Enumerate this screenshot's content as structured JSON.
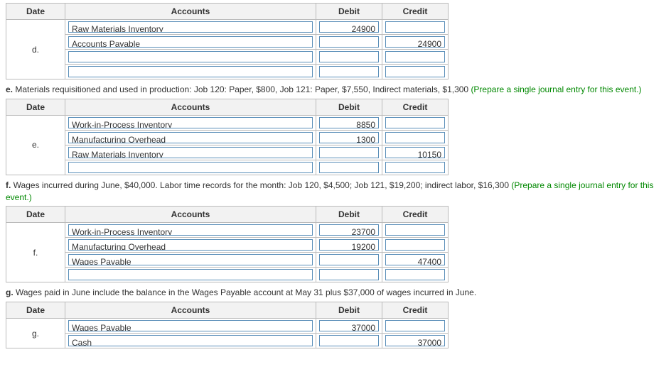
{
  "headers": {
    "date": "Date",
    "accounts": "Accounts",
    "debit": "Debit",
    "credit": "Credit"
  },
  "entries": [
    {
      "id": "d",
      "narrative": null,
      "rows": [
        {
          "account": "Raw Materials Inventory",
          "debit": "24900",
          "credit": ""
        },
        {
          "account": "Accounts Payable",
          "debit": "",
          "credit": "24900"
        },
        {
          "account": "",
          "debit": "",
          "credit": ""
        },
        {
          "account": "",
          "debit": "",
          "credit": ""
        }
      ]
    },
    {
      "id": "e",
      "narrative": {
        "letter": "e.",
        "text": " Materials requisitioned and used in production: Job 120: Paper, $800, Job 121: Paper, $7,550, Indirect materials, $1,300 ",
        "green": "(Prepare a single journal entry for this event.)"
      },
      "rows": [
        {
          "account": "Work-in-Process Inventory",
          "debit": "8850",
          "credit": ""
        },
        {
          "account": "Manufacturing Overhead",
          "debit": "1300",
          "credit": ""
        },
        {
          "account": "Raw Materials Inventory",
          "debit": "",
          "credit": "10150"
        },
        {
          "account": "",
          "debit": "",
          "credit": ""
        }
      ]
    },
    {
      "id": "f",
      "narrative": {
        "letter": "f.",
        "text": " Wages incurred during June, $40,000. Labor time records for the month: Job 120, $4,500; Job 121, $19,200; indirect labor, $16,300 ",
        "green": "(Prepare a single journal entry for this event.)"
      },
      "rows": [
        {
          "account": "Work-in-Process Inventory",
          "debit": "23700",
          "credit": ""
        },
        {
          "account": "Manufacturing Overhead",
          "debit": "19200",
          "credit": ""
        },
        {
          "account": "Wages Payable",
          "debit": "",
          "credit": "47400"
        },
        {
          "account": "",
          "debit": "",
          "credit": ""
        }
      ]
    },
    {
      "id": "g",
      "narrative": {
        "letter": "g.",
        "text": " Wages paid in June include the balance in the Wages Payable account at May 31 plus $37,000 of wages incurred in June.",
        "green": ""
      },
      "rows": [
        {
          "account": "Wages Payable",
          "debit": "37000",
          "credit": ""
        },
        {
          "account": "Cash",
          "debit": "",
          "credit": "37000"
        }
      ]
    }
  ]
}
